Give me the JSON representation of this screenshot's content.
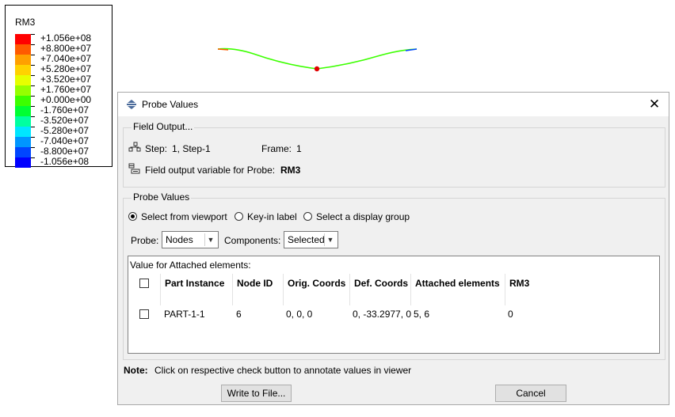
{
  "legend": {
    "title": "RM3",
    "entries": [
      {
        "value": "+1.056e+08",
        "color": "#ff0000"
      },
      {
        "value": "+8.800e+07",
        "color": "#ff5a00"
      },
      {
        "value": "+7.040e+07",
        "color": "#ffa000"
      },
      {
        "value": "+5.280e+07",
        "color": "#ffd200"
      },
      {
        "value": "+3.520e+07",
        "color": "#e6ff00"
      },
      {
        "value": "+1.760e+07",
        "color": "#96ff00"
      },
      {
        "value": "+0.000e+00",
        "color": "#3cff00"
      },
      {
        "value": "-1.760e+07",
        "color": "#00ff32"
      },
      {
        "value": "-3.520e+07",
        "color": "#00ffa0"
      },
      {
        "value": "-5.280e+07",
        "color": "#00e6ff"
      },
      {
        "value": "-7.040e+07",
        "color": "#0096ff"
      },
      {
        "value": "-8.800e+07",
        "color": "#0046ff"
      },
      {
        "value": "-1.056e+08",
        "color": "#0000ff"
      }
    ]
  },
  "dialog": {
    "title": "Probe Values",
    "field_output": {
      "group_label": "Field Output...",
      "step_label": "Step:",
      "step_value": "1, Step-1",
      "frame_label": "Frame:",
      "frame_value": "1",
      "variable_label": "Field output variable for Probe:",
      "variable_value": "RM3"
    },
    "probe_values": {
      "group_label": "Probe Values",
      "radios": [
        "Select from viewport",
        "Key-in label",
        "Select a display group"
      ],
      "selected_radio": 0,
      "probe_label": "Probe:",
      "probe_value": "Nodes",
      "components_label": "Components:",
      "components_value": "Selected"
    },
    "table": {
      "caption": "Value for Attached elements:",
      "columns": [
        "Part Instance",
        "Node ID",
        "Orig. Coords",
        "Def. Coords",
        "Attached elements",
        "RM3"
      ],
      "rows": [
        [
          "PART-1-1",
          "6",
          "0, 0, 0",
          "0, -33.2977, 0",
          "5, 6",
          "0"
        ]
      ]
    },
    "note_label": "Note:",
    "note_text": "Click on respective check button to annotate values in viewer",
    "write_button": "Write to File...",
    "cancel_button": "Cancel"
  }
}
